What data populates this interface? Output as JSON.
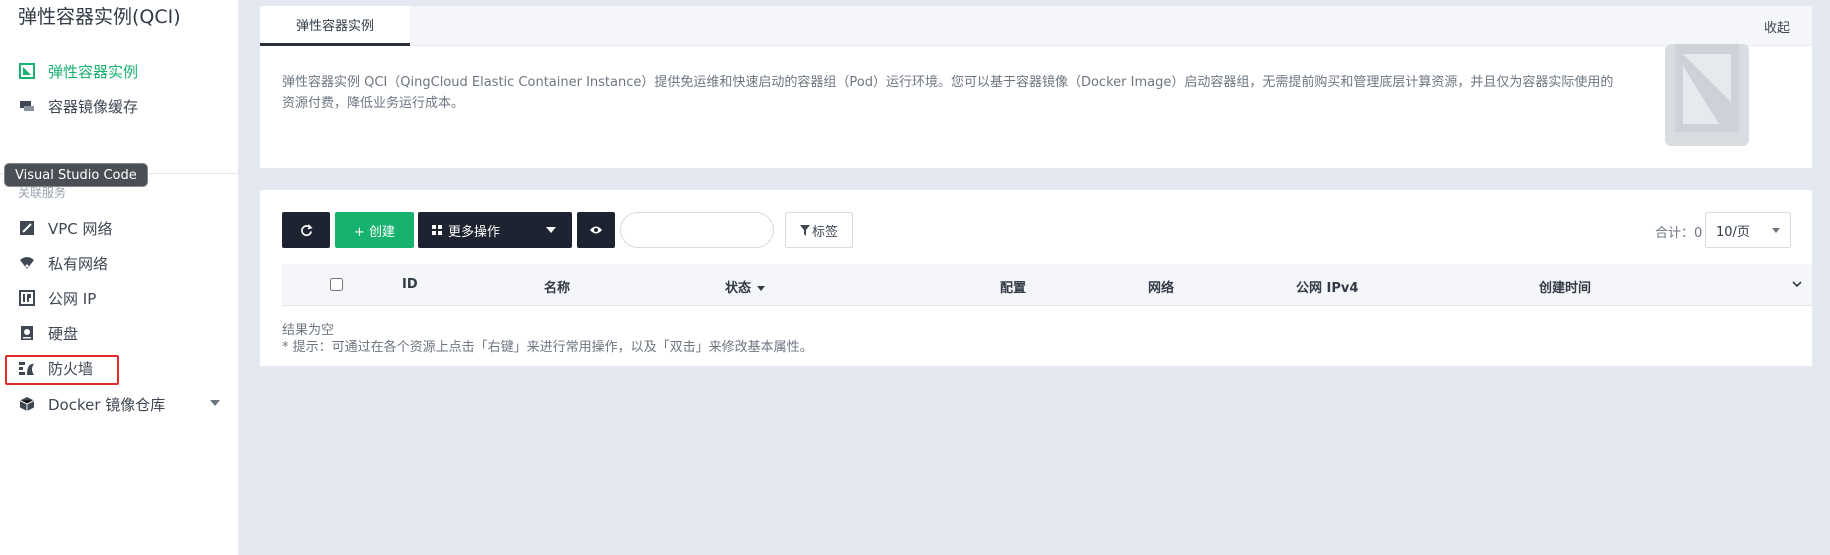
{
  "sidebar": {
    "title": "弹性容器实例(QCI)",
    "items": [
      {
        "label": "弹性容器实例",
        "icon": "instance-icon",
        "active": true
      },
      {
        "label": "容器镜像缓存",
        "icon": "cache-icon"
      }
    ],
    "section_title": "关联服务",
    "related": [
      {
        "label": "VPC 网络",
        "icon": "vpc-icon"
      },
      {
        "label": "私有网络",
        "icon": "wifi-icon"
      },
      {
        "label": "公网 IP",
        "icon": "ip-icon"
      },
      {
        "label": "硬盘",
        "icon": "disk-icon"
      },
      {
        "label": "防火墙",
        "icon": "firewall-icon"
      },
      {
        "label": "Docker 镜像仓库",
        "icon": "cube-icon"
      }
    ]
  },
  "tooltip": "Visual Studio Code",
  "header": {
    "tab": "弹性容器实例",
    "collapse": "收起",
    "description": "弹性容器实例 QCI（QingCloud Elastic Container Instance）提供免运维和快速启动的容器组（Pod）运行环境。您可以基于容器镜像（Docker Image）启动容器组，无需提前购买和管理底层计算资源，并且仅为容器实际使用的资源付费，降低业务运行成本。"
  },
  "toolbar": {
    "create": "+ 创建",
    "more": "更多操作",
    "tag": "标签",
    "search_placeholder": "",
    "total": "合计：0",
    "page_size": "10/页"
  },
  "table": {
    "columns": [
      "ID",
      "名称",
      "状态",
      "配置",
      "网络",
      "公网 IPv4",
      "创建时间"
    ],
    "empty": "结果为空",
    "hint": "* 提示：可通过在各个资源上点击「右键」来进行常用操作，以及「双击」来修改基本属性。"
  },
  "colors": {
    "accent": "#17b26d",
    "dark_button": "#1d2330",
    "highlight": "#e02b2b"
  }
}
